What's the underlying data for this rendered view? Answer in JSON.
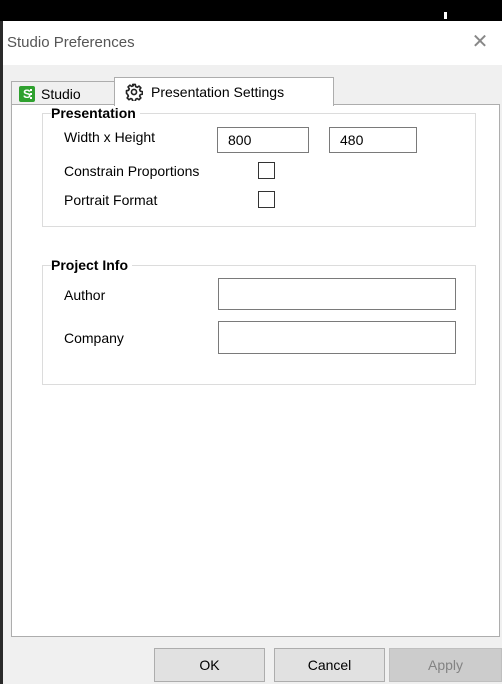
{
  "window": {
    "title": "Studio Preferences",
    "close_glyph": "✕"
  },
  "tabs": [
    {
      "label": "Studio",
      "icon": "studio-s-icon",
      "icon_letter": "S"
    },
    {
      "label": "Presentation Settings",
      "icon": "gear-icon",
      "selected": true
    }
  ],
  "presentation": {
    "legend": "Presentation",
    "size_label": "Width x Height",
    "width_value": "800",
    "height_value": "480",
    "constrain_label": "Constrain Proportions",
    "constrain_checked": false,
    "portrait_label": "Portrait Format",
    "portrait_checked": false
  },
  "project_info": {
    "legend": "Project Info",
    "author_label": "Author",
    "author_value": "",
    "company_label": "Company",
    "company_value": ""
  },
  "buttons": {
    "ok": "OK",
    "cancel": "Cancel",
    "apply": "Apply"
  },
  "colors": {
    "studio_icon": "#2fa12f",
    "disabled_text": "#838383"
  }
}
